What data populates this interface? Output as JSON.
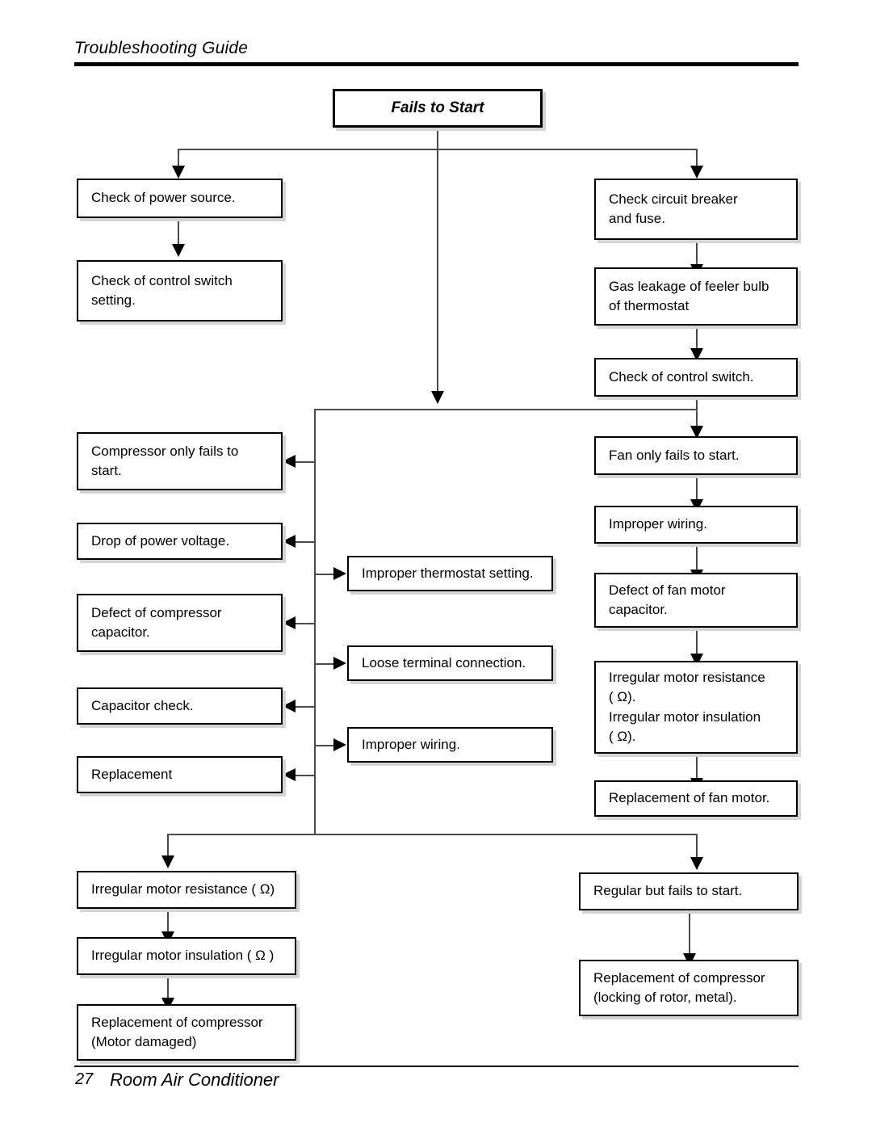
{
  "header": {
    "title": "Troubleshooting Guide"
  },
  "footer": {
    "page_number": "27",
    "label": "Room Air Conditioner"
  },
  "colors": {
    "ink": "#000000",
    "line": "#4a4a4a",
    "shadow": "#d5d5d5",
    "background": "#ffffff"
  },
  "chart_data": {
    "type": "diagram",
    "title": "Fails to Start",
    "nodes": [
      {
        "id": "start",
        "label": "Fails to Start"
      },
      {
        "id": "power_source",
        "label": "Check of power source."
      },
      {
        "id": "control_setting",
        "label": "Check of control switch\nsetting."
      },
      {
        "id": "breaker_fuse",
        "label": "Check circuit breaker\nand fuse."
      },
      {
        "id": "gas_leakage",
        "label": "Gas leakage of feeler bulb\nof thermostat"
      },
      {
        "id": "control_switch",
        "label": "Check of control switch."
      },
      {
        "id": "comp_only_fails",
        "label": "Compressor only fails to\nstart."
      },
      {
        "id": "drop_voltage",
        "label": "Drop of power voltage."
      },
      {
        "id": "defect_comp_cap",
        "label": "Defect of compressor\ncapacitor."
      },
      {
        "id": "capacitor_check",
        "label": "Capacitor check."
      },
      {
        "id": "replacement",
        "label": "Replacement"
      },
      {
        "id": "improper_thermo",
        "label": "Improper thermostat setting."
      },
      {
        "id": "loose_terminal",
        "label": "Loose terminal connection."
      },
      {
        "id": "improper_wiring_c",
        "label": "Improper wiring."
      },
      {
        "id": "fan_only_fails",
        "label": "Fan only fails to start."
      },
      {
        "id": "improper_wiring_r",
        "label": "Improper wiring."
      },
      {
        "id": "defect_fan_cap",
        "label": "Defect of fan motor\ncapacitor."
      },
      {
        "id": "irregular_fan",
        "label": "Irregular motor resistance\n( Ω).\nIrregular motor insulation\n( Ω)."
      },
      {
        "id": "replace_fan_motor",
        "label": "Replacement of fan motor."
      },
      {
        "id": "irr_resistance",
        "label": "Irregular motor resistance ( Ω)"
      },
      {
        "id": "irr_insulation",
        "label": "Irregular motor insulation ( Ω )"
      },
      {
        "id": "replace_comp_mtr",
        "label": "Replacement of compressor\n(Motor damaged)"
      },
      {
        "id": "regular_fails",
        "label": "Regular but fails to start."
      },
      {
        "id": "replace_comp_lock",
        "label": "Replacement of compressor\n(locking of rotor, metal)."
      }
    ],
    "edges": [
      {
        "from": "start",
        "to": "power_source"
      },
      {
        "from": "start",
        "to": "breaker_fuse"
      },
      {
        "from": "start",
        "to": "trunk"
      },
      {
        "from": "power_source",
        "to": "control_setting"
      },
      {
        "from": "breaker_fuse",
        "to": "gas_leakage"
      },
      {
        "from": "gas_leakage",
        "to": "control_switch"
      },
      {
        "from": "control_switch",
        "to": "fan_only_fails"
      },
      {
        "from": "trunk",
        "to": "comp_only_fails"
      },
      {
        "from": "trunk",
        "to": "drop_voltage"
      },
      {
        "from": "trunk",
        "to": "defect_comp_cap"
      },
      {
        "from": "trunk",
        "to": "capacitor_check"
      },
      {
        "from": "trunk",
        "to": "replacement"
      },
      {
        "from": "trunk",
        "to": "improper_thermo"
      },
      {
        "from": "trunk",
        "to": "loose_terminal"
      },
      {
        "from": "trunk",
        "to": "improper_wiring_c"
      },
      {
        "from": "trunk",
        "to": "irr_resistance"
      },
      {
        "from": "trunk",
        "to": "regular_fails"
      },
      {
        "from": "fan_only_fails",
        "to": "improper_wiring_r"
      },
      {
        "from": "improper_wiring_r",
        "to": "defect_fan_cap"
      },
      {
        "from": "defect_fan_cap",
        "to": "irregular_fan"
      },
      {
        "from": "irregular_fan",
        "to": "replace_fan_motor"
      },
      {
        "from": "irr_resistance",
        "to": "irr_insulation"
      },
      {
        "from": "irr_insulation",
        "to": "replace_comp_mtr"
      },
      {
        "from": "regular_fails",
        "to": "replace_comp_lock"
      }
    ]
  }
}
